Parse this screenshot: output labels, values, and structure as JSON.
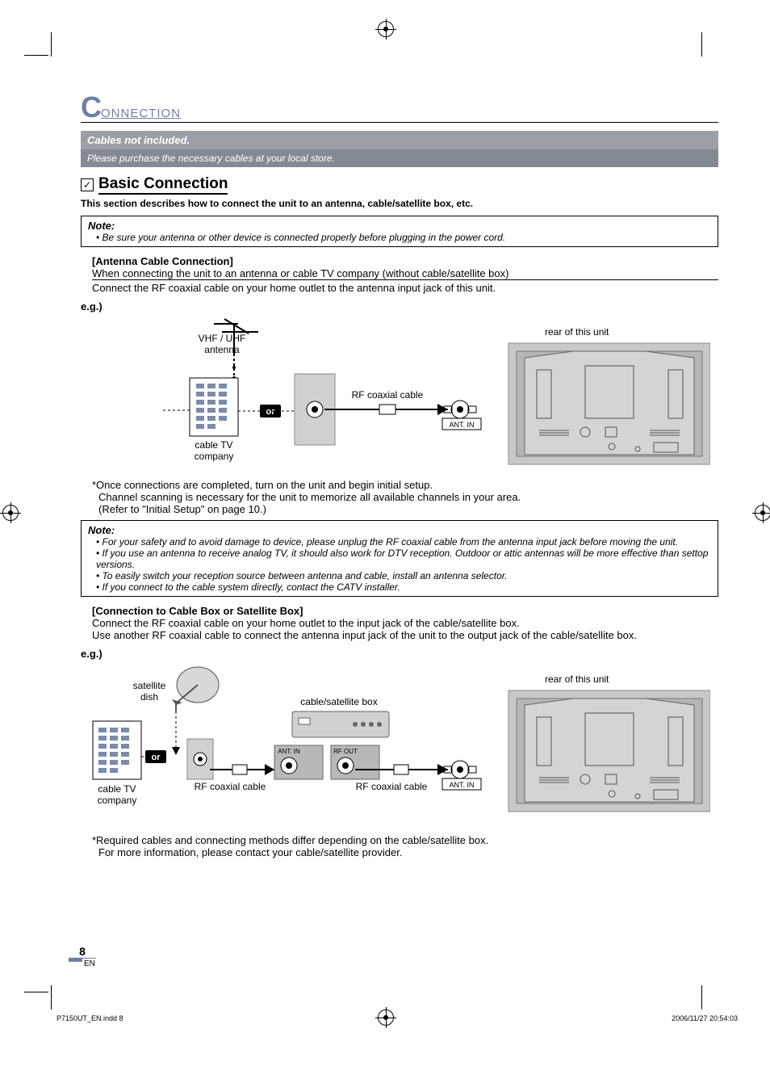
{
  "header": {
    "title_letter": "C",
    "title_rest": "ONNECTION"
  },
  "banner": {
    "line1": "Cables not included.",
    "line2": "Please purchase the necessary cables at your local store."
  },
  "section": {
    "check": "✓",
    "title": "Basic Connection",
    "desc": "This section describes how to connect the unit to an antenna, cable/satellite box, etc."
  },
  "note1": {
    "title": "Note:",
    "line1": "• Be sure your antenna or other device is connected properly before plugging in the power cord."
  },
  "antenna": {
    "heading": "[Antenna Cable Connection]",
    "line1": "When connecting the unit to an antenna or cable TV company (without cable/satellite box)",
    "line2": "Connect the RF coaxial cable on your home outlet to the antenna input jack of this unit.",
    "eg": "e.g.)",
    "diagram": {
      "vhf_label": "VHF / UHF\nantenna",
      "or_label": "or",
      "cable_tv_label": "cable TV\ncompany",
      "rf_label": "RF coaxial cable",
      "ant_in": "ANT. IN",
      "rear_label": "rear of this unit"
    },
    "after1": "*Once connections are completed, turn on the unit and begin initial setup.",
    "after2": "Channel scanning is necessary for the unit to memorize all available channels in your area.",
    "after3": "(Refer to \"Initial Setup\" on page 10.)"
  },
  "note2": {
    "title": "Note:",
    "l1": "• For your safety and to avoid damage to device, please unplug the RF coaxial cable from the antenna input jack before moving the unit.",
    "l2": "• If you use an antenna to receive analog TV, it should also work for DTV reception. Outdoor or attic antennas will be more effective than settop versions.",
    "l3": "• To easily switch your reception source between antenna and cable, install an antenna selector.",
    "l4": "• If you connect to the cable system directly, contact the CATV installer."
  },
  "cablebox": {
    "heading": "[Connection to Cable Box or Satellite Box]",
    "line1": "Connect the RF coaxial cable on your home outlet to the input jack of the cable/satellite box.",
    "line2": "Use another RF coaxial cable to connect the antenna input jack of the unit to the output jack of the cable/satellite box.",
    "eg": "e.g.)",
    "diagram": {
      "sat_label": "satellite\ndish",
      "or_label": "or",
      "cable_tv_label": "cable TV\ncompany",
      "box_label": "cable/satellite box",
      "ant_in_box": "ANT. IN",
      "rf_out": "RF OUT",
      "rf_label1": "RF coaxial cable",
      "rf_label2": "RF coaxial cable",
      "ant_in": "ANT. IN",
      "rear_label": "rear of this unit"
    },
    "after1": "*Required cables and connecting methods differ depending on the cable/satellite box.",
    "after2": "For more information, please contact your cable/satellite provider."
  },
  "footer": {
    "page_num": "8",
    "en": "EN",
    "file": "P7150UT_EN.indd   8",
    "date": "2006/11/27   20:54:03"
  }
}
